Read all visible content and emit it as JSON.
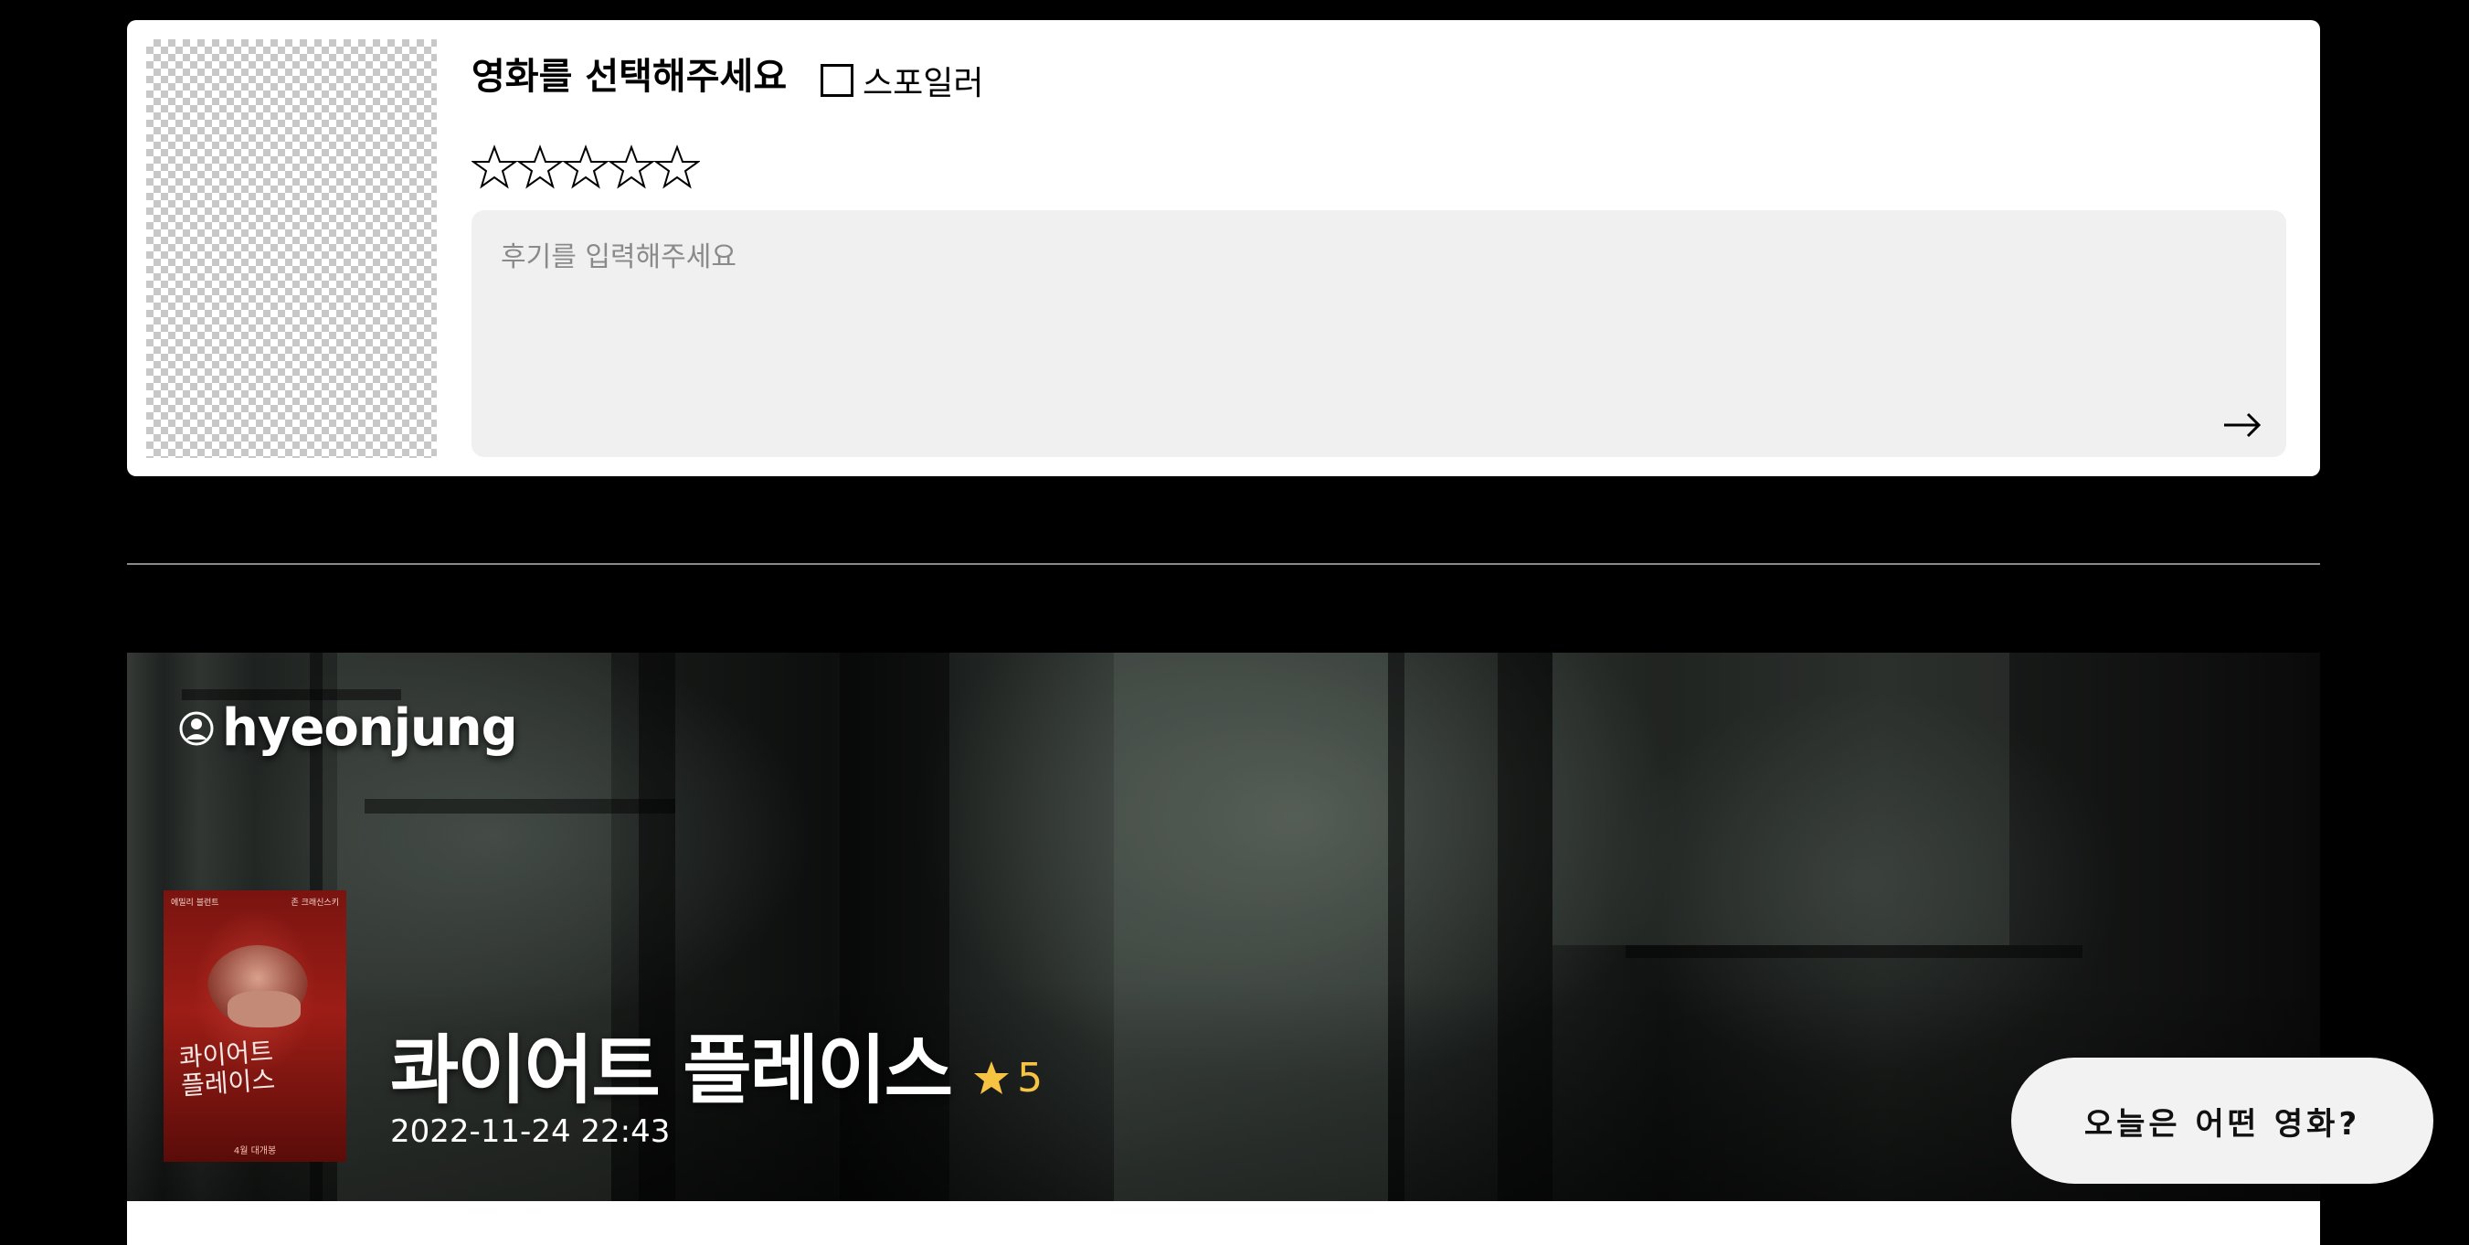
{
  "composer": {
    "title": "영화를 선택해주세요",
    "spoiler_label": "스포일러",
    "spoiler_checked": false,
    "rating": 0,
    "rating_max": 5,
    "review_placeholder": "후기를 입력해주세요",
    "review_value": "",
    "submit_icon": "arrow-right-icon"
  },
  "review": {
    "user_icon": "user-circle-icon",
    "username": "hyeonjung",
    "movie_title": "콰이어트 플레이스",
    "rating_icon": "star-icon",
    "rating_color": "#f6c343",
    "rating": "5",
    "date": "2022-11-24 22:43",
    "poster": {
      "top_left": "에밀리 블런트",
      "top_right": "존 크래신스키",
      "title_line1": "콰이어트",
      "title_line2": "플레이스",
      "release": "4월 대개봉"
    }
  },
  "fab": {
    "label": "오늘은 어떤 영화?"
  }
}
